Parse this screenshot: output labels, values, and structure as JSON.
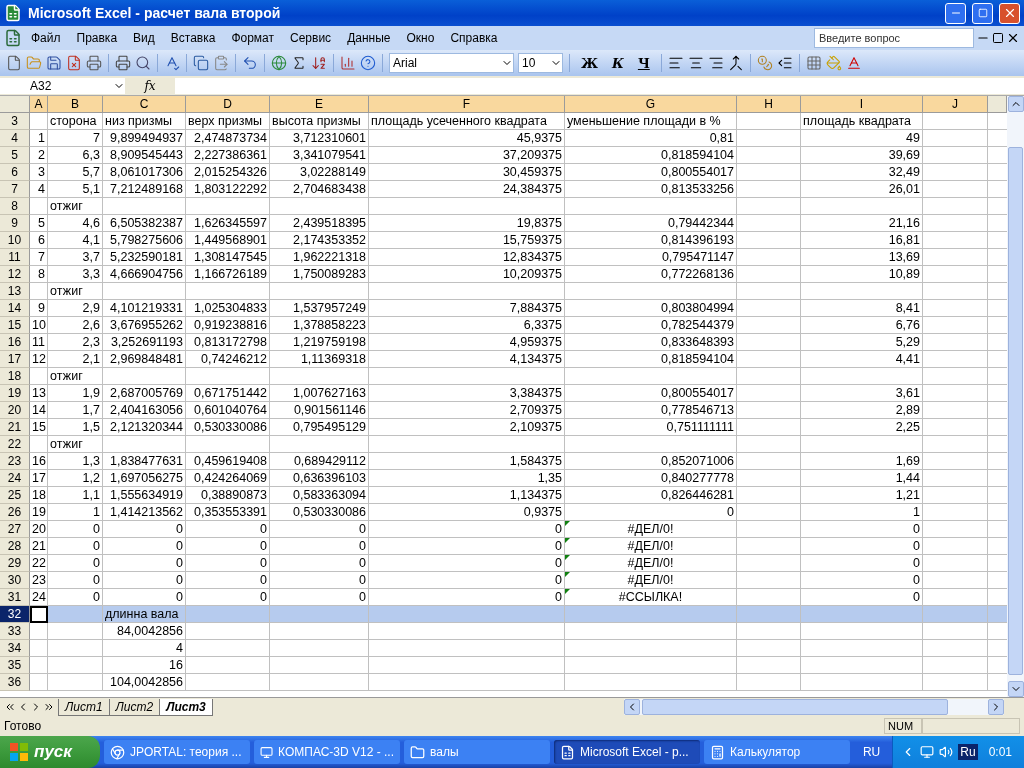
{
  "window": {
    "title": "Microsoft Excel - расчет вала второй"
  },
  "menu": {
    "items": [
      "Файл",
      "Правка",
      "Вид",
      "Вставка",
      "Формат",
      "Сервис",
      "Данные",
      "Окно",
      "Справка"
    ],
    "help_placeholder": "Введите вопрос"
  },
  "toolbar": {
    "font": "Arial",
    "size": "10",
    "format_buttons": [
      "Ж",
      "К",
      "Ч"
    ]
  },
  "formula_bar": {
    "name_box": "A32",
    "fx": "fx"
  },
  "columns": [
    "A",
    "B",
    "C",
    "D",
    "E",
    "F",
    "G",
    "H",
    "I",
    "J"
  ],
  "rows": [
    {
      "num": "3",
      "kind": "text",
      "selected": false,
      "flagged": false,
      "cells": [
        "",
        "сторона",
        "низ призмы",
        "верх призмы",
        "высота призмы",
        "площадь усеченного квадрата",
        "уменьшение площади в %",
        "",
        "площадь квадрата",
        ""
      ]
    },
    {
      "num": "4",
      "kind": "number",
      "selected": false,
      "flagged": false,
      "cells": [
        "1",
        "7",
        "9,899494937",
        "2,474873734",
        "3,712310601",
        "45,9375",
        "0,81",
        "",
        "49",
        ""
      ]
    },
    {
      "num": "5",
      "kind": "number",
      "selected": false,
      "flagged": false,
      "cells": [
        "2",
        "6,3",
        "8,909545443",
        "2,227386361",
        "3,341079541",
        "37,209375",
        "0,818594104",
        "",
        "39,69",
        ""
      ]
    },
    {
      "num": "6",
      "kind": "number",
      "selected": false,
      "flagged": false,
      "cells": [
        "3",
        "5,7",
        "8,061017306",
        "2,015254326",
        "3,02288149",
        "30,459375",
        "0,800554017",
        "",
        "32,49",
        ""
      ]
    },
    {
      "num": "7",
      "kind": "number",
      "selected": false,
      "flagged": false,
      "cells": [
        "4",
        "5,1",
        "7,212489168",
        "1,803122292",
        "2,704683438",
        "24,384375",
        "0,813533256",
        "",
        "26,01",
        ""
      ]
    },
    {
      "num": "8",
      "kind": "text",
      "selected": false,
      "flagged": false,
      "cells": [
        "",
        "отжиг",
        "",
        "",
        "",
        "",
        "",
        "",
        "",
        ""
      ]
    },
    {
      "num": "9",
      "kind": "number",
      "selected": false,
      "flagged": false,
      "cells": [
        "5",
        "4,6",
        "6,505382387",
        "1,626345597",
        "2,439518395",
        "19,8375",
        "0,79442344",
        "",
        "21,16",
        ""
      ]
    },
    {
      "num": "10",
      "kind": "number",
      "selected": false,
      "flagged": false,
      "cells": [
        "6",
        "4,1",
        "5,798275606",
        "1,449568901",
        "2,174353352",
        "15,759375",
        "0,814396193",
        "",
        "16,81",
        ""
      ]
    },
    {
      "num": "11",
      "kind": "number",
      "selected": false,
      "flagged": false,
      "cells": [
        "7",
        "3,7",
        "5,232590181",
        "1,308147545",
        "1,962221318",
        "12,834375",
        "0,795471147",
        "",
        "13,69",
        ""
      ]
    },
    {
      "num": "12",
      "kind": "number",
      "selected": false,
      "flagged": false,
      "cells": [
        "8",
        "3,3",
        "4,666904756",
        "1,166726189",
        "1,750089283",
        "10,209375",
        "0,772268136",
        "",
        "10,89",
        ""
      ]
    },
    {
      "num": "13",
      "kind": "text",
      "selected": false,
      "flagged": false,
      "cells": [
        "",
        "отжиг",
        "",
        "",
        "",
        "",
        "",
        "",
        "",
        ""
      ]
    },
    {
      "num": "14",
      "kind": "number",
      "selected": false,
      "flagged": false,
      "cells": [
        "9",
        "2,9",
        "4,101219331",
        "1,025304833",
        "1,537957249",
        "7,884375",
        "0,803804994",
        "",
        "8,41",
        ""
      ]
    },
    {
      "num": "15",
      "kind": "number",
      "selected": false,
      "flagged": false,
      "cells": [
        "10",
        "2,6",
        "3,676955262",
        "0,919238816",
        "1,378858223",
        "6,3375",
        "0,782544379",
        "",
        "6,76",
        ""
      ]
    },
    {
      "num": "16",
      "kind": "number",
      "selected": false,
      "flagged": false,
      "cells": [
        "11",
        "2,3",
        "3,252691193",
        "0,813172798",
        "1,219759198",
        "4,959375",
        "0,833648393",
        "",
        "5,29",
        ""
      ]
    },
    {
      "num": "17",
      "kind": "number",
      "selected": false,
      "flagged": false,
      "cells": [
        "12",
        "2,1",
        "2,969848481",
        "0,74246212",
        "1,11369318",
        "4,134375",
        "0,818594104",
        "",
        "4,41",
        ""
      ]
    },
    {
      "num": "18",
      "kind": "text",
      "selected": false,
      "flagged": false,
      "cells": [
        "",
        "отжиг",
        "",
        "",
        "",
        "",
        "",
        "",
        "",
        ""
      ]
    },
    {
      "num": "19",
      "kind": "number",
      "selected": false,
      "flagged": false,
      "cells": [
        "13",
        "1,9",
        "2,687005769",
        "0,671751442",
        "1,007627163",
        "3,384375",
        "0,800554017",
        "",
        "3,61",
        ""
      ]
    },
    {
      "num": "20",
      "kind": "number",
      "selected": false,
      "flagged": false,
      "cells": [
        "14",
        "1,7",
        "2,404163056",
        "0,601040764",
        "0,901561146",
        "2,709375",
        "0,778546713",
        "",
        "2,89",
        ""
      ]
    },
    {
      "num": "21",
      "kind": "number",
      "selected": false,
      "flagged": false,
      "cells": [
        "15",
        "1,5",
        "2,121320344",
        "0,530330086",
        "0,795495129",
        "2,109375",
        "0,751111111",
        "",
        "2,25",
        ""
      ]
    },
    {
      "num": "22",
      "kind": "text",
      "selected": false,
      "flagged": false,
      "cells": [
        "",
        "отжиг",
        "",
        "",
        "",
        "",
        "",
        "",
        "",
        ""
      ]
    },
    {
      "num": "23",
      "kind": "number",
      "selected": false,
      "flagged": false,
      "cells": [
        "16",
        "1,3",
        "1,838477631",
        "0,459619408",
        "0,689429112",
        "1,584375",
        "0,852071006",
        "",
        "1,69",
        ""
      ]
    },
    {
      "num": "24",
      "kind": "number",
      "selected": false,
      "flagged": false,
      "cells": [
        "17",
        "1,2",
        "1,697056275",
        "0,424264069",
        "0,636396103",
        "1,35",
        "0,840277778",
        "",
        "1,44",
        ""
      ]
    },
    {
      "num": "25",
      "kind": "number",
      "selected": false,
      "flagged": false,
      "cells": [
        "18",
        "1,1",
        "1,555634919",
        "0,38890873",
        "0,583363094",
        "1,134375",
        "0,826446281",
        "",
        "1,21",
        ""
      ]
    },
    {
      "num": "26",
      "kind": "number",
      "selected": false,
      "flagged": false,
      "cells": [
        "19",
        "1",
        "1,414213562",
        "0,353553391",
        "0,530330086",
        "0,9375",
        "0",
        "",
        "1",
        ""
      ]
    },
    {
      "num": "27",
      "kind": "error",
      "selected": false,
      "flagged": true,
      "cells": [
        "20",
        "0",
        "0",
        "0",
        "0",
        "0",
        "#ДЕЛ/0!",
        "",
        "0",
        ""
      ]
    },
    {
      "num": "28",
      "kind": "error",
      "selected": false,
      "flagged": true,
      "cells": [
        "21",
        "0",
        "0",
        "0",
        "0",
        "0",
        "#ДЕЛ/0!",
        "",
        "0",
        ""
      ]
    },
    {
      "num": "29",
      "kind": "error",
      "selected": false,
      "flagged": true,
      "cells": [
        "22",
        "0",
        "0",
        "0",
        "0",
        "0",
        "#ДЕЛ/0!",
        "",
        "0",
        ""
      ]
    },
    {
      "num": "30",
      "kind": "error",
      "selected": false,
      "flagged": true,
      "cells": [
        "23",
        "0",
        "0",
        "0",
        "0",
        "0",
        "#ДЕЛ/0!",
        "",
        "0",
        ""
      ]
    },
    {
      "num": "31",
      "kind": "error",
      "selected": false,
      "flagged": true,
      "cells": [
        "24",
        "0",
        "0",
        "0",
        "0",
        "0",
        "#ССЫЛКА!",
        "",
        "0",
        ""
      ]
    },
    {
      "num": "32",
      "kind": "text",
      "selected": true,
      "flagged": false,
      "cells": [
        "",
        "",
        "длинна вала",
        "",
        "",
        "",
        "",
        "",
        "",
        ""
      ]
    },
    {
      "num": "33",
      "kind": "number",
      "selected": false,
      "flagged": false,
      "cells": [
        "",
        "",
        "84,0042856",
        "",
        "",
        "",
        "",
        "",
        "",
        ""
      ]
    },
    {
      "num": "34",
      "kind": "number",
      "selected": false,
      "flagged": false,
      "cells": [
        "",
        "",
        "4",
        "",
        "",
        "",
        "",
        "",
        "",
        ""
      ]
    },
    {
      "num": "35",
      "kind": "number",
      "selected": false,
      "flagged": false,
      "cells": [
        "",
        "",
        "16",
        "",
        "",
        "",
        "",
        "",
        "",
        ""
      ]
    },
    {
      "num": "36",
      "kind": "number",
      "selected": false,
      "flagged": false,
      "cells": [
        "",
        "",
        "104,0042856",
        "",
        "",
        "",
        "",
        "",
        "",
        ""
      ]
    }
  ],
  "sheet_tabs": [
    {
      "label": "Лист1",
      "selected": false
    },
    {
      "label": "Лист2",
      "selected": false
    },
    {
      "label": "Лист3",
      "selected": true
    }
  ],
  "status_bar": {
    "text": "Готово",
    "indicator": "NUM"
  },
  "taskbar": {
    "start": "пуск",
    "tasks": [
      {
        "label": "JPORTAL: теория ...",
        "kind": "browser",
        "selected": false
      },
      {
        "label": "КОМПАС-3D V12 - ...",
        "kind": "cad",
        "selected": false
      },
      {
        "label": "валы",
        "kind": "folder",
        "selected": false
      },
      {
        "label": "Microsoft Excel - р...",
        "kind": "excel",
        "selected": true
      },
      {
        "label": "Калькулятор",
        "kind": "calc",
        "selected": false
      }
    ],
    "language": "RU",
    "tray_language": "Ru",
    "clock": "0:01"
  }
}
